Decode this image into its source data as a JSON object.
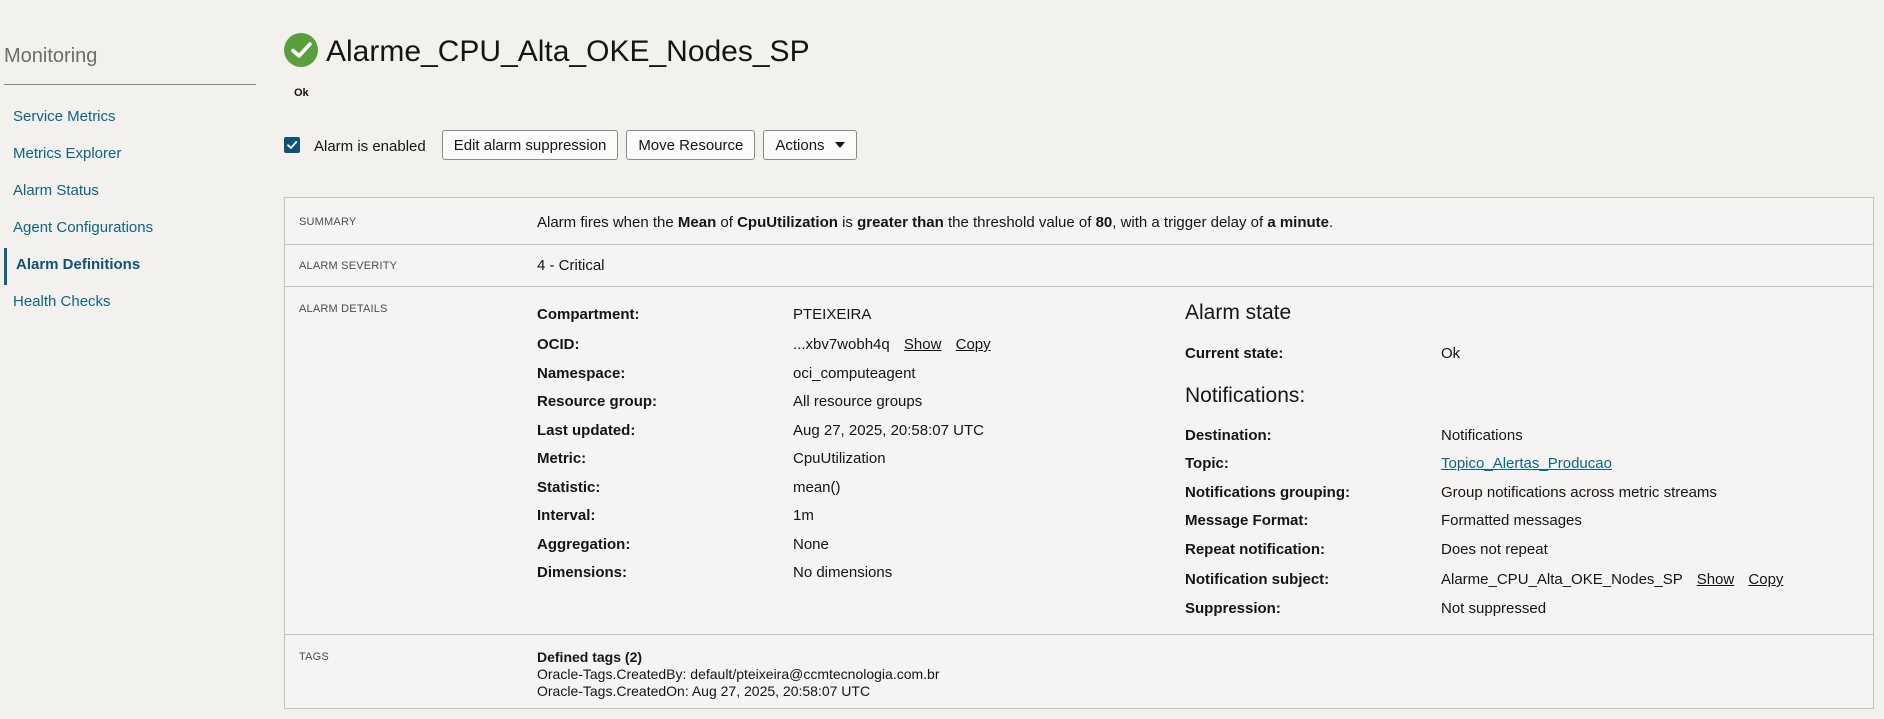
{
  "sidebar": {
    "title": "Monitoring",
    "items": [
      {
        "label": "Service Metrics"
      },
      {
        "label": "Metrics Explorer"
      },
      {
        "label": "Alarm Status"
      },
      {
        "label": "Agent Configurations"
      },
      {
        "label": "Alarm Definitions",
        "active": true
      },
      {
        "label": "Health Checks"
      }
    ]
  },
  "header": {
    "status_icon": "check-circle-icon",
    "status_color": "#5a9f3e",
    "title": "Alarme_CPU_Alta_OKE_Nodes_SP",
    "status": "Ok"
  },
  "toolbar": {
    "enabled_checked": true,
    "enabled_label": "Alarm is enabled",
    "edit_suppression_label": "Edit alarm suppression",
    "move_resource_label": "Move Resource",
    "actions_label": "Actions"
  },
  "summary": {
    "label": "SUMMARY",
    "t1": "Alarm fires when the ",
    "b1": "Mean",
    "t2": " of ",
    "b2": "CpuUtilization",
    "t3": " is ",
    "b3": "greater than",
    "t4": " the threshold value of ",
    "b4": "80",
    "t5": ", with a trigger delay of ",
    "b5": "a minute",
    "t6": "."
  },
  "severity": {
    "label": "ALARM SEVERITY",
    "value": "4 - Critical"
  },
  "details": {
    "label": "ALARM DETAILS",
    "compartment_label": "Compartment:",
    "compartment_value": "PTEIXEIRA",
    "ocid_label": "OCID:",
    "ocid_value": "...xbv7wobh4q",
    "show_label": "Show",
    "copy_label": "Copy",
    "namespace_label": "Namespace:",
    "namespace_value": "oci_computeagent",
    "resource_group_label": "Resource group:",
    "resource_group_value": "All resource groups",
    "last_updated_label": "Last updated:",
    "last_updated_value": "Aug 27, 2025, 20:58:07 UTC",
    "metric_label": "Metric:",
    "metric_value": "CpuUtilization",
    "statistic_label": "Statistic:",
    "statistic_value": "mean()",
    "interval_label": "Interval:",
    "interval_value": "1m",
    "aggregation_label": "Aggregation:",
    "aggregation_value": "None",
    "dimensions_label": "Dimensions:",
    "dimensions_value": "No dimensions"
  },
  "alarm_state": {
    "heading": "Alarm state",
    "current_state_label": "Current state:",
    "current_state_value": "Ok"
  },
  "notifications": {
    "heading": "Notifications:",
    "destination_label": "Destination:",
    "destination_value": "Notifications",
    "topic_label": "Topic:",
    "topic_value": "Topico_Alertas_Producao",
    "grouping_label": "Notifications grouping:",
    "grouping_value": "Group notifications across metric streams",
    "format_label": "Message Format:",
    "format_value": "Formatted messages",
    "repeat_label": "Repeat notification:",
    "repeat_value": "Does not repeat",
    "subject_label": "Notification subject:",
    "subject_value": "Alarme_CPU_Alta_OKE_Nodes_SP",
    "show_label": "Show",
    "copy_label": "Copy",
    "suppression_label": "Suppression:",
    "suppression_value": "Not suppressed"
  },
  "tags": {
    "label": "TAGS",
    "heading": "Defined tags (2)",
    "line1": "Oracle-Tags.CreatedBy: default/pteixeira@ccmtecnologia.com.br",
    "line2": "Oracle-Tags.CreatedOn: Aug 27, 2025, 20:58:07 UTC"
  }
}
